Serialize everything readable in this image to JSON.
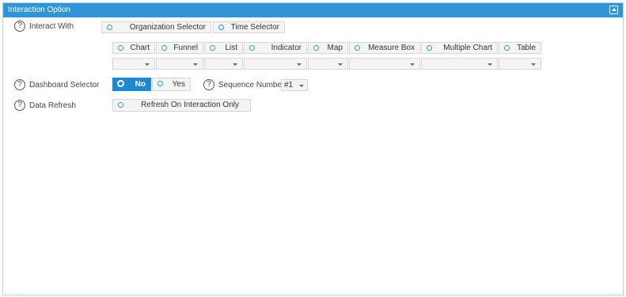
{
  "panel": {
    "title": "Interaction Option"
  },
  "interact_with": {
    "label": "Interact With",
    "selectors": [
      "Organization Selector",
      "Time Selector"
    ],
    "widgets": [
      "Chart",
      "Funnel",
      "List",
      "Indicator",
      "Map",
      "Measure Box",
      "Multiple Chart",
      "Table"
    ]
  },
  "dashboard_selector": {
    "label": "Dashboard Selector",
    "options": [
      "No",
      "Yes"
    ],
    "selected": "No",
    "sequence_label": "Sequence Number",
    "sequence_value": "#1"
  },
  "data_refresh": {
    "label": "Data Refresh",
    "option": "Refresh On Interaction Only"
  },
  "colors": {
    "header": "#2f95d6",
    "selected": "#1f88d0"
  }
}
